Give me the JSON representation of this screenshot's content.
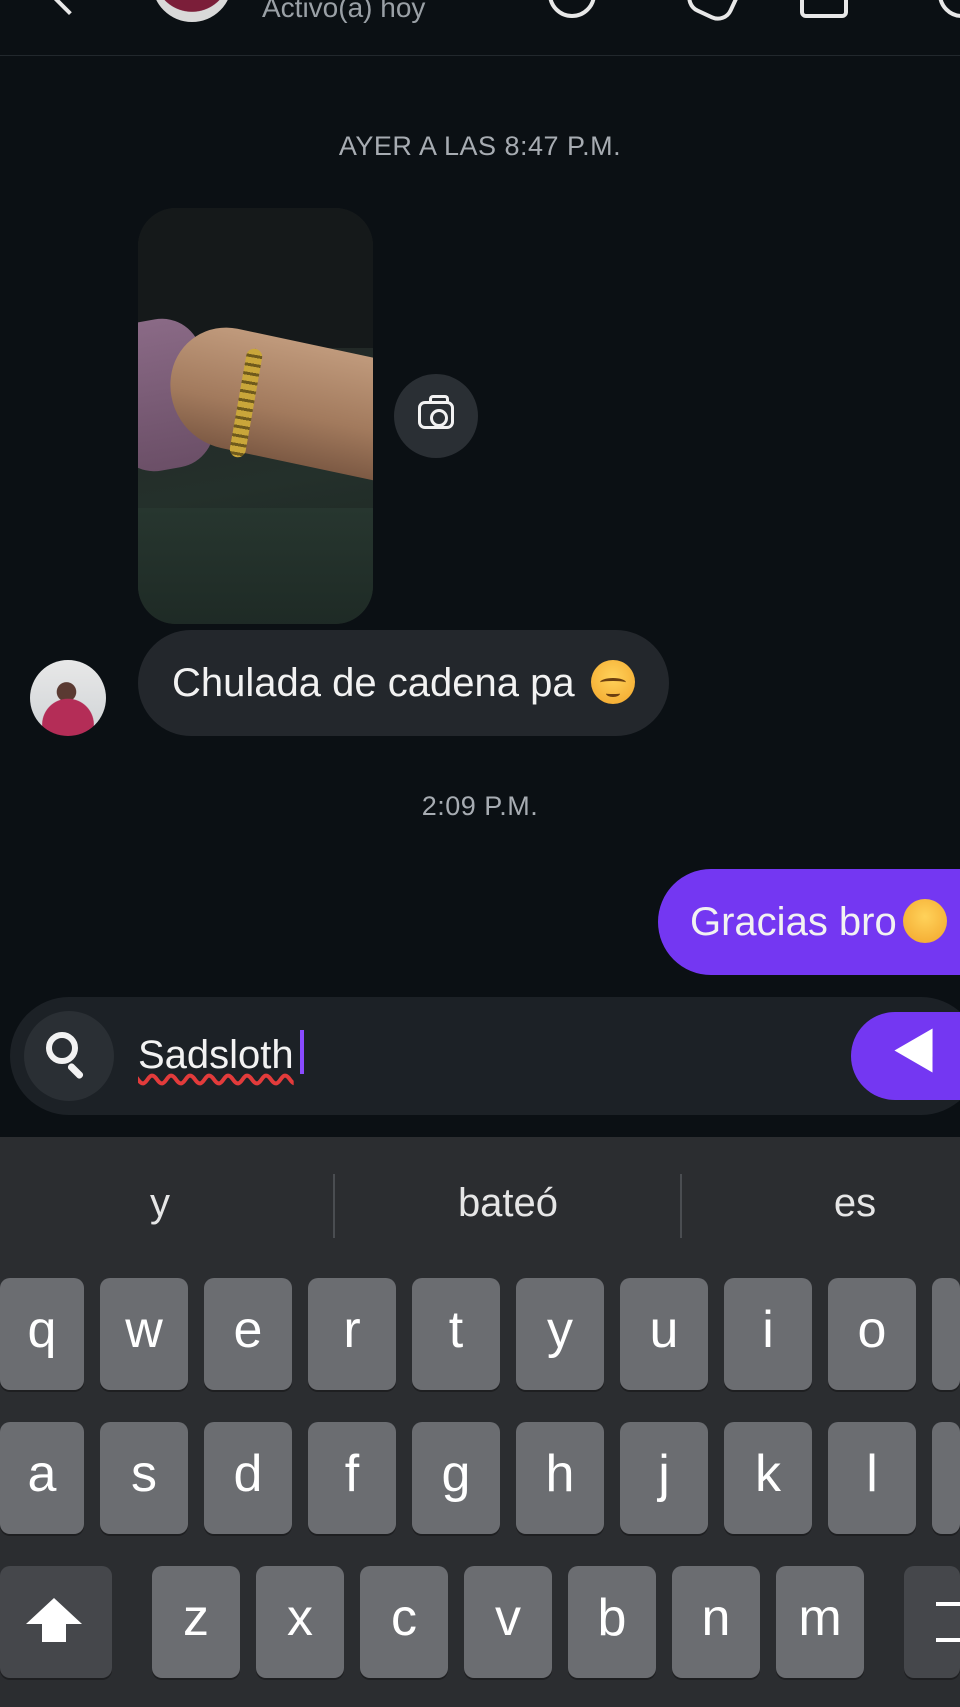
{
  "header": {
    "status": "Activo(a) hoy"
  },
  "conversation": {
    "timestamp_1": "AYER A LAS 8:47 P.M.",
    "incoming_message": "Chulada de cadena pa",
    "timestamp_2": "2:09 P.M.",
    "outgoing_message": "Gracias bro"
  },
  "composer": {
    "input_value": "Sadsloth"
  },
  "keyboard": {
    "suggestions": [
      "y",
      "bateó",
      "es"
    ],
    "row1": [
      "q",
      "w",
      "e",
      "r",
      "t",
      "y",
      "u",
      "i",
      "o"
    ],
    "row2": [
      "a",
      "s",
      "d",
      "f",
      "g",
      "h",
      "j",
      "k",
      "l"
    ],
    "row3": [
      "z",
      "x",
      "c",
      "v",
      "b",
      "n",
      "m"
    ]
  },
  "colors": {
    "background": "#0b1014",
    "accent": "#7437f2",
    "incoming_bubble": "#23272c",
    "keyboard_bg": "#2b2d30",
    "key_bg": "#6b6d71"
  },
  "icons": [
    "back-icon",
    "audio-call-icon",
    "video-call-icon",
    "flag-icon",
    "info-icon",
    "camera-icon",
    "search-icon",
    "send-icon",
    "shift-icon",
    "backspace-icon"
  ]
}
